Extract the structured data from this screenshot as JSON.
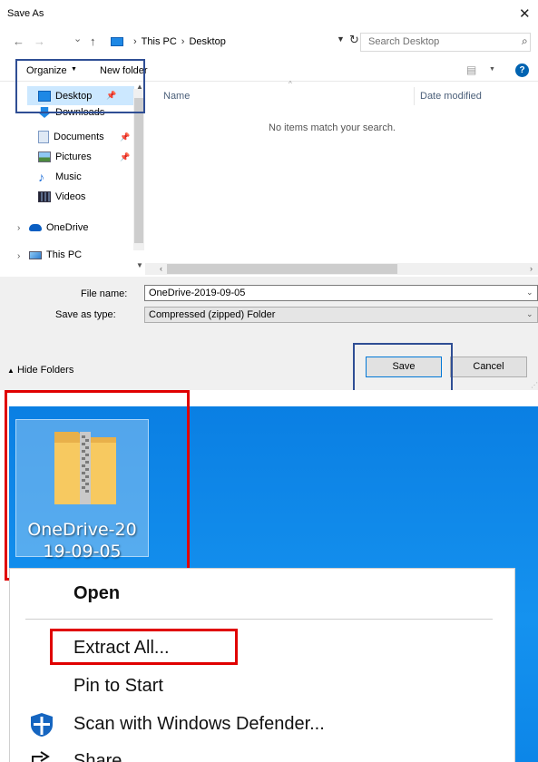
{
  "dialog": {
    "title": "Save As",
    "close_glyph": "✕",
    "nav": {
      "back": "←",
      "forward": "→",
      "recent": "⌄",
      "up": "↑"
    },
    "breadcrumb": [
      "This PC",
      "Desktop"
    ],
    "breadcrumb_sep": "›",
    "search_placeholder": "Search Desktop",
    "toolbar": {
      "organize": "Organize",
      "new_folder": "New folder"
    },
    "nav_pane": {
      "items": [
        {
          "label": "Desktop",
          "icon": "desktop-icon",
          "pinned": true
        },
        {
          "label": "Downloads",
          "icon": "downloads-icon",
          "pinned": true
        },
        {
          "label": "Documents",
          "icon": "documents-icon",
          "pinned": true
        },
        {
          "label": "Pictures",
          "icon": "pictures-icon",
          "pinned": true
        },
        {
          "label": "Music",
          "icon": "music-icon",
          "pinned": false
        },
        {
          "label": "Videos",
          "icon": "videos-icon",
          "pinned": false
        },
        {
          "label": "OneDrive",
          "icon": "onedrive-icon",
          "pinned": false
        },
        {
          "label": "This PC",
          "icon": "this-pc-icon",
          "pinned": false
        }
      ]
    },
    "columns": {
      "name": "Name",
      "date": "Date modified"
    },
    "empty_message": "No items match your search.",
    "file_name_label": "File name:",
    "file_name_value": "OneDrive-2019-09-05",
    "save_type_label": "Save as type:",
    "save_type_value": "Compressed (zipped) Folder",
    "hide_folders": "Hide Folders",
    "save_button": "Save",
    "cancel_button": "Cancel"
  },
  "desktop": {
    "zip_label_line1": "OneDrive-20",
    "zip_label_line2": "19-09-05",
    "context_menu": {
      "open": "Open",
      "extract_all": "Extract All...",
      "pin_to_start": "Pin to Start",
      "scan": "Scan with Windows Defender...",
      "share": "Share"
    }
  },
  "colors": {
    "accent": "#0078d7",
    "highlight_blue": "#2f4e94",
    "highlight_red": "#e00000",
    "desktop_blue": "#1592ef"
  }
}
